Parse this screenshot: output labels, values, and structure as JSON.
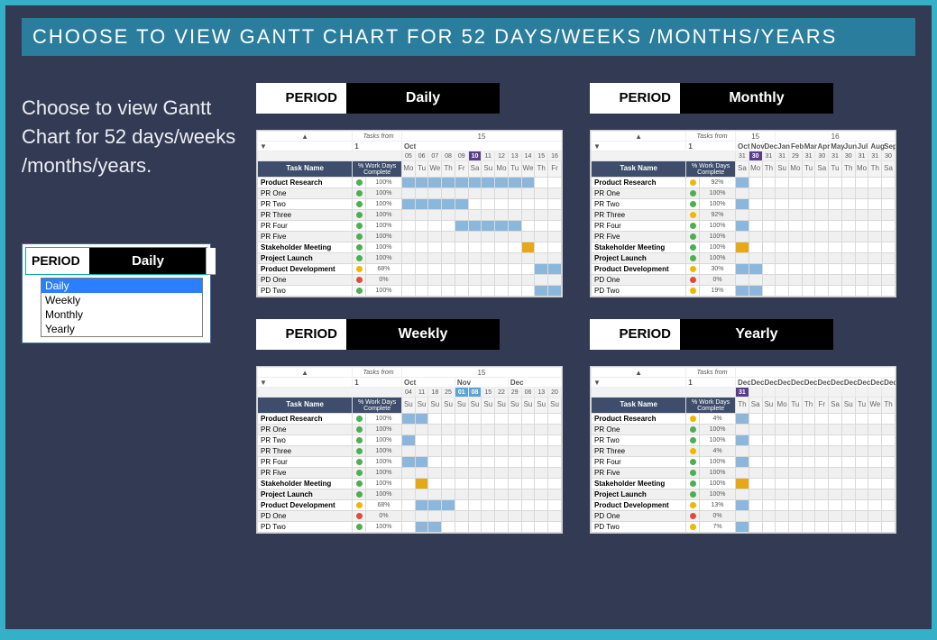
{
  "banner": "CHOOSE TO VIEW GANTT CHART FOR 52 DAYS/WEEKS /MONTHS/YEARS",
  "description": "Choose to view Gantt Chart for 52 days/weeks /months/years.",
  "period_widget": {
    "label": "PERIOD",
    "value": "Daily",
    "options": [
      "Daily",
      "Weekly",
      "Monthly",
      "Yearly"
    ],
    "selected": "Daily"
  },
  "common": {
    "tasks_from": "Tasks from",
    "one": "1",
    "task_name_header": "Task Name",
    "pct_header": "% Work Days Complete",
    "nav_up": "▲",
    "nav_down": "▼"
  },
  "tasks": [
    {
      "name": "Product Research",
      "bold": true
    },
    {
      "name": "PR One"
    },
    {
      "name": "PR Two"
    },
    {
      "name": "PR Three"
    },
    {
      "name": "PR Four"
    },
    {
      "name": "PR Five"
    },
    {
      "name": "Stakeholder Meeting",
      "bold": true
    },
    {
      "name": "Project Launch",
      "bold": true
    },
    {
      "name": "Product Development",
      "bold": true
    },
    {
      "name": "PD One"
    },
    {
      "name": "PD Two"
    }
  ],
  "charts": {
    "daily": {
      "period_label": "PERIOD",
      "period_value": "Daily",
      "year_header": "15",
      "months": [
        "Oct"
      ],
      "days": [
        "Mo",
        "Tu",
        "We",
        "Th",
        "Fr",
        "Sa",
        "Su",
        "Mo",
        "Tu",
        "We",
        "Th",
        "Fr"
      ],
      "dates": [
        "05",
        "06",
        "07",
        "08",
        "09",
        "10",
        "11",
        "12",
        "13",
        "14",
        "15",
        "16"
      ],
      "today_col": 5,
      "rows": [
        {
          "dot": "green",
          "pct": "100%",
          "bars": [
            0,
            1,
            2,
            3,
            4,
            5,
            6,
            7,
            8,
            9
          ],
          "color": "bar"
        },
        {
          "dot": "green",
          "pct": "100%",
          "bars": [
            0,
            1,
            2,
            3,
            4
          ],
          "color": "bar"
        },
        {
          "dot": "green",
          "pct": "100%",
          "bars": [
            0,
            1,
            2,
            3,
            4
          ],
          "color": "bar"
        },
        {
          "dot": "green",
          "pct": "100%",
          "bars": [
            2,
            3,
            4,
            5,
            6
          ],
          "color": "bar"
        },
        {
          "dot": "green",
          "pct": "100%",
          "bars": [
            4,
            5,
            6,
            7,
            8
          ],
          "color": "bar"
        },
        {
          "dot": "green",
          "pct": "100%",
          "bars": [
            6,
            7,
            8,
            9
          ],
          "color": "bar"
        },
        {
          "dot": "green",
          "pct": "100%",
          "bars": [
            9
          ],
          "color": "barY"
        },
        {
          "dot": "green",
          "pct": "100%",
          "bars": [
            10
          ],
          "color": "bar"
        },
        {
          "dot": "yellow",
          "pct": "68%",
          "bars": [
            10,
            11
          ],
          "color": "bar"
        },
        {
          "dot": "red",
          "pct": "0%",
          "bars": [
            10,
            11
          ],
          "color": "bar"
        },
        {
          "dot": "green",
          "pct": "100%",
          "bars": [
            10,
            11
          ],
          "color": "bar"
        }
      ]
    },
    "weekly": {
      "period_label": "PERIOD",
      "period_value": "Weekly",
      "year_header": "15",
      "months": [
        "Oct",
        "Nov",
        "Dec"
      ],
      "days": [
        "Su",
        "Su",
        "Su",
        "Su",
        "Su",
        "Su",
        "Su",
        "Su",
        "Su",
        "Su",
        "Su",
        "Su"
      ],
      "dates": [
        "04",
        "11",
        "18",
        "25",
        "01",
        "08",
        "15",
        "22",
        "29",
        "06",
        "13",
        "20"
      ],
      "today_cols": [
        4,
        5
      ],
      "rows": [
        {
          "dot": "green",
          "pct": "100%",
          "bars": [
            0,
            1
          ],
          "color": "bar"
        },
        {
          "dot": "green",
          "pct": "100%",
          "bars": [
            0
          ],
          "color": "bar"
        },
        {
          "dot": "green",
          "pct": "100%",
          "bars": [
            0
          ],
          "color": "bar"
        },
        {
          "dot": "green",
          "pct": "100%",
          "bars": [
            0,
            1
          ],
          "color": "bar"
        },
        {
          "dot": "green",
          "pct": "100%",
          "bars": [
            0,
            1
          ],
          "color": "bar"
        },
        {
          "dot": "green",
          "pct": "100%",
          "bars": [
            1
          ],
          "color": "bar"
        },
        {
          "dot": "green",
          "pct": "100%",
          "bars": [
            1
          ],
          "color": "barY"
        },
        {
          "dot": "green",
          "pct": "100%",
          "bars": [
            1
          ],
          "color": "bar"
        },
        {
          "dot": "yellow",
          "pct": "68%",
          "bars": [
            1,
            2,
            3
          ],
          "color": "bar"
        },
        {
          "dot": "red",
          "pct": "0%",
          "bars": [
            1,
            2
          ],
          "color": "bar"
        },
        {
          "dot": "green",
          "pct": "100%",
          "bars": [
            1,
            2
          ],
          "color": "bar"
        }
      ]
    },
    "monthly": {
      "period_label": "PERIOD",
      "period_value": "Monthly",
      "year_headers": [
        "15",
        "16"
      ],
      "months": [
        "Oct",
        "Nov",
        "Dec",
        "Jan",
        "Feb",
        "Mar",
        "Apr",
        "May",
        "Jun",
        "Jul",
        "Aug",
        "Sep"
      ],
      "days": [
        "Sa",
        "Mo",
        "Th",
        "Su",
        "Mo",
        "Tu",
        "Sa",
        "Tu",
        "Th",
        "Mo",
        "Th",
        "Sa"
      ],
      "dates": [
        "31",
        "30",
        "31",
        "31",
        "29",
        "31",
        "30",
        "31",
        "30",
        "31",
        "31",
        "30"
      ],
      "today_col": 1,
      "rows": [
        {
          "dot": "yellow",
          "pct": "92%",
          "bars": [
            0
          ],
          "color": "bar"
        },
        {
          "dot": "green",
          "pct": "100%",
          "bars": [
            0
          ],
          "color": "bar"
        },
        {
          "dot": "green",
          "pct": "100%",
          "bars": [
            0
          ],
          "color": "bar"
        },
        {
          "dot": "yellow",
          "pct": "92%",
          "bars": [
            0
          ],
          "color": "bar"
        },
        {
          "dot": "green",
          "pct": "100%",
          "bars": [
            0
          ],
          "color": "bar"
        },
        {
          "dot": "green",
          "pct": "100%",
          "bars": [
            0
          ],
          "color": "bar"
        },
        {
          "dot": "green",
          "pct": "100%",
          "bars": [
            0
          ],
          "color": "barY"
        },
        {
          "dot": "green",
          "pct": "100%",
          "bars": [
            0
          ],
          "color": "bar"
        },
        {
          "dot": "yellow",
          "pct": "30%",
          "bars": [
            0,
            1
          ],
          "color": "bar"
        },
        {
          "dot": "red",
          "pct": "0%",
          "bars": [
            0
          ],
          "color": "bar"
        },
        {
          "dot": "yellow",
          "pct": "19%",
          "bars": [
            0,
            1
          ],
          "color": "bar"
        }
      ]
    },
    "yearly": {
      "period_label": "PERIOD",
      "period_value": "Yearly",
      "year_header": "",
      "months": [
        "Dec",
        "Dec",
        "Dec",
        "Dec",
        "Dec",
        "Dec",
        "Dec",
        "Dec",
        "Dec",
        "Dec",
        "Dec",
        "Dec"
      ],
      "days": [
        "Th",
        "Sa",
        "Su",
        "Mo",
        "Tu",
        "Th",
        "Fr",
        "Sa",
        "Su",
        "Tu",
        "We",
        "Th"
      ],
      "dates": [
        "31",
        "",
        "",
        "",
        "",
        "",
        "",
        "",
        "",
        "",
        "",
        ""
      ],
      "today_col": 0,
      "rows": [
        {
          "dot": "yellow",
          "pct": "4%",
          "bars": [
            0
          ],
          "color": "bar"
        },
        {
          "dot": "green",
          "pct": "100%",
          "bars": [
            0
          ],
          "color": "bar"
        },
        {
          "dot": "green",
          "pct": "100%",
          "bars": [
            0
          ],
          "color": "bar"
        },
        {
          "dot": "yellow",
          "pct": "4%",
          "bars": [
            0
          ],
          "color": "bar"
        },
        {
          "dot": "green",
          "pct": "100%",
          "bars": [
            0
          ],
          "color": "bar"
        },
        {
          "dot": "green",
          "pct": "100%",
          "bars": [
            0
          ],
          "color": "bar"
        },
        {
          "dot": "green",
          "pct": "100%",
          "bars": [
            0
          ],
          "color": "barY"
        },
        {
          "dot": "green",
          "pct": "100%",
          "bars": [
            0
          ],
          "color": "bar"
        },
        {
          "dot": "yellow",
          "pct": "13%",
          "bars": [
            0
          ],
          "color": "bar"
        },
        {
          "dot": "red",
          "pct": "0%",
          "bars": [
            0
          ],
          "color": "bar"
        },
        {
          "dot": "yellow",
          "pct": "7%",
          "bars": [
            0
          ],
          "color": "bar"
        }
      ]
    }
  },
  "chart_data": [
    {
      "type": "gantt",
      "period": "Daily",
      "tasks": [
        "Product Research",
        "PR One",
        "PR Two",
        "PR Three",
        "PR Four",
        "PR Five",
        "Stakeholder Meeting",
        "Project Launch",
        "Product Development",
        "PD One",
        "PD Two"
      ],
      "pct_complete": [
        100,
        100,
        100,
        100,
        100,
        100,
        100,
        100,
        68,
        0,
        100
      ],
      "columns": [
        "05",
        "06",
        "07",
        "08",
        "09",
        "10",
        "11",
        "12",
        "13",
        "14",
        "15",
        "16"
      ],
      "bars": [
        [
          0,
          9
        ],
        [
          0,
          4
        ],
        [
          0,
          4
        ],
        [
          2,
          6
        ],
        [
          4,
          8
        ],
        [
          6,
          9
        ],
        [
          9,
          9
        ],
        [
          10,
          10
        ],
        [
          10,
          11
        ],
        [
          10,
          11
        ],
        [
          10,
          11
        ]
      ]
    },
    {
      "type": "gantt",
      "period": "Weekly",
      "tasks": [
        "Product Research",
        "PR One",
        "PR Two",
        "PR Three",
        "PR Four",
        "PR Five",
        "Stakeholder Meeting",
        "Project Launch",
        "Product Development",
        "PD One",
        "PD Two"
      ],
      "pct_complete": [
        100,
        100,
        100,
        100,
        100,
        100,
        100,
        100,
        68,
        0,
        100
      ],
      "columns": [
        "Oct 04",
        "Oct 11",
        "Oct 18",
        "Oct 25",
        "Nov 01",
        "Nov 08",
        "Nov 15",
        "Nov 22",
        "Nov 29",
        "Dec 06",
        "Dec 13",
        "Dec 20"
      ],
      "bars": [
        [
          0,
          1
        ],
        [
          0,
          0
        ],
        [
          0,
          0
        ],
        [
          0,
          1
        ],
        [
          0,
          1
        ],
        [
          1,
          1
        ],
        [
          1,
          1
        ],
        [
          1,
          1
        ],
        [
          1,
          3
        ],
        [
          1,
          2
        ],
        [
          1,
          2
        ]
      ]
    },
    {
      "type": "gantt",
      "period": "Monthly",
      "tasks": [
        "Product Research",
        "PR One",
        "PR Two",
        "PR Three",
        "PR Four",
        "PR Five",
        "Stakeholder Meeting",
        "Project Launch",
        "Product Development",
        "PD One",
        "PD Two"
      ],
      "pct_complete": [
        92,
        100,
        100,
        92,
        100,
        100,
        100,
        100,
        30,
        0,
        19
      ],
      "columns": [
        "Oct",
        "Nov",
        "Dec",
        "Jan",
        "Feb",
        "Mar",
        "Apr",
        "May",
        "Jun",
        "Jul",
        "Aug",
        "Sep"
      ],
      "bars": [
        [
          0,
          0
        ],
        [
          0,
          0
        ],
        [
          0,
          0
        ],
        [
          0,
          0
        ],
        [
          0,
          0
        ],
        [
          0,
          0
        ],
        [
          0,
          0
        ],
        [
          0,
          0
        ],
        [
          0,
          1
        ],
        [
          0,
          0
        ],
        [
          0,
          1
        ]
      ]
    },
    {
      "type": "gantt",
      "period": "Yearly",
      "tasks": [
        "Product Research",
        "PR One",
        "PR Two",
        "PR Three",
        "PR Four",
        "PR Five",
        "Stakeholder Meeting",
        "Project Launch",
        "Product Development",
        "PD One",
        "PD Two"
      ],
      "pct_complete": [
        4,
        100,
        100,
        4,
        100,
        100,
        100,
        100,
        13,
        0,
        7
      ],
      "columns": [
        "Dec 31"
      ],
      "bars": [
        [
          0,
          0
        ],
        [
          0,
          0
        ],
        [
          0,
          0
        ],
        [
          0,
          0
        ],
        [
          0,
          0
        ],
        [
          0,
          0
        ],
        [
          0,
          0
        ],
        [
          0,
          0
        ],
        [
          0,
          0
        ],
        [
          0,
          0
        ],
        [
          0,
          0
        ]
      ]
    }
  ]
}
